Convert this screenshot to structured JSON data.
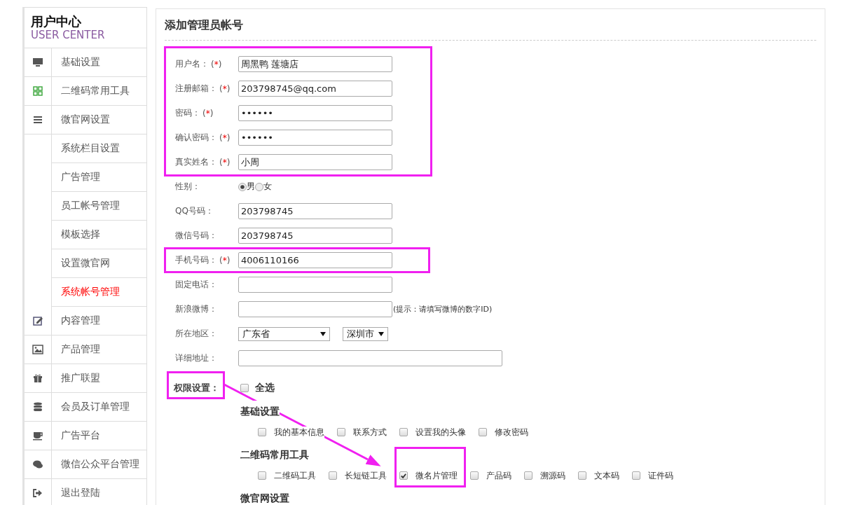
{
  "sidebar": {
    "title": "用户中心",
    "subtitle": "USER CENTER",
    "items": [
      {
        "label": "基础设置",
        "selected": false
      },
      {
        "label": "二维码常用工具",
        "selected": false
      },
      {
        "label": "微官网设置",
        "selected": false,
        "expanded": true,
        "children": [
          {
            "label": "系统栏目设置",
            "selected": false
          },
          {
            "label": "广告管理",
            "selected": false
          },
          {
            "label": "员工帐号管理",
            "selected": false
          },
          {
            "label": "模板选择",
            "selected": false
          },
          {
            "label": "设置微官网",
            "selected": false
          },
          {
            "label": "系统帐号管理",
            "selected": true
          }
        ]
      },
      {
        "label": "内容管理",
        "selected": false
      },
      {
        "label": "产品管理",
        "selected": false
      },
      {
        "label": "推广联盟",
        "selected": false
      },
      {
        "label": "会员及订单管理",
        "selected": false
      },
      {
        "label": "广告平台",
        "selected": false
      },
      {
        "label": "微信公众平台管理",
        "selected": false
      },
      {
        "label": "退出登陆",
        "selected": false
      }
    ]
  },
  "panel": {
    "title": "添加管理员帐号",
    "fields": [
      {
        "kind": "text",
        "label": "用户名：",
        "required_mark": "(*)",
        "value": "周黑鸭 莲塘店"
      },
      {
        "kind": "text",
        "label": "注册邮箱：",
        "required_mark": "(*)",
        "value": "203798745@qq.com"
      },
      {
        "kind": "text",
        "label": "密码：",
        "required_mark": "(*)",
        "value": "••••••"
      },
      {
        "kind": "text",
        "label": "确认密码：",
        "required_mark": "(*)",
        "value": "••••••"
      },
      {
        "kind": "text",
        "label": "真实姓名：",
        "required_mark": "(*)",
        "value": "小周"
      },
      {
        "kind": "radio",
        "label": "性别：",
        "options": [
          {
            "label": "男",
            "selected": true
          },
          {
            "label": "女",
            "selected": false
          }
        ]
      },
      {
        "kind": "text",
        "label": "QQ号码：",
        "value": "203798745"
      },
      {
        "kind": "text",
        "label": "微信号码：",
        "value": "203798745"
      },
      {
        "kind": "text",
        "label": "手机号码：",
        "required_mark": "(*)",
        "value": "4006110166"
      },
      {
        "kind": "text",
        "label": "固定电话："
      },
      {
        "kind": "text",
        "label": "新浪微博：",
        "hint": "(提示：请填写微博的数字ID)"
      },
      {
        "kind": "select",
        "label": "所在地区：",
        "selects": [
          {
            "value": "广东省"
          },
          {
            "value": "深圳市"
          }
        ]
      },
      {
        "kind": "address",
        "label": "详细地址："
      }
    ],
    "permissions": {
      "label": "权限设置：",
      "select_all": {
        "label": "全选",
        "checked": false
      },
      "groups": [
        {
          "title": "基础设置",
          "items": [
            {
              "label": "我的基本信息",
              "checked": false
            },
            {
              "label": "联系方式",
              "checked": false
            },
            {
              "label": "设置我的头像",
              "checked": false
            },
            {
              "label": "修改密码",
              "checked": false
            }
          ]
        },
        {
          "title": "二维码常用工具",
          "items": [
            {
              "label": "二维码工具",
              "checked": false
            },
            {
              "label": "长短链工具",
              "checked": false
            },
            {
              "label": "微名片管理",
              "checked": true
            },
            {
              "label": "产品码",
              "checked": false
            },
            {
              "label": "溯源码",
              "checked": false
            },
            {
              "label": "文本码",
              "checked": false
            },
            {
              "label": "证件码",
              "checked": false
            }
          ]
        },
        {
          "title": "微官网设置"
        }
      ]
    }
  }
}
